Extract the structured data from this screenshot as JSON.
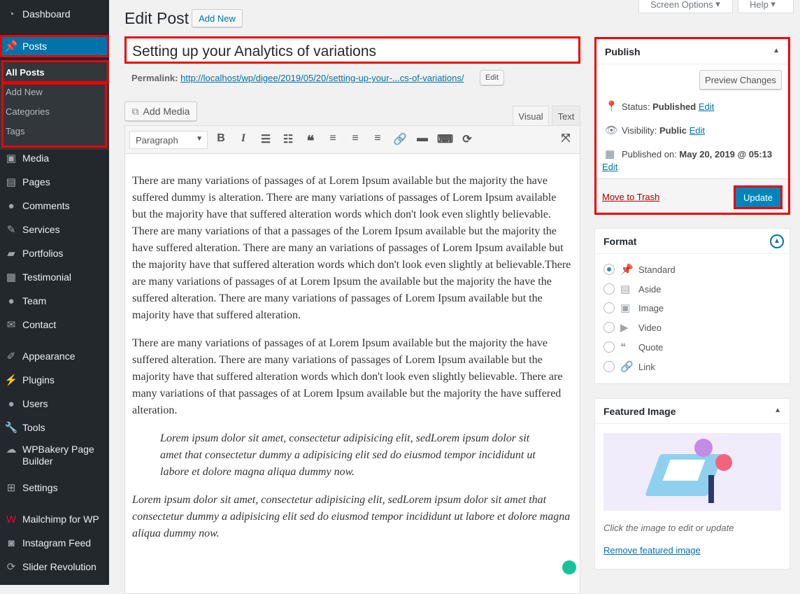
{
  "sidebar": {
    "items": [
      {
        "label": "Dashboard",
        "icon": "dashboard-icon"
      },
      {
        "label": "Posts",
        "icon": "pin-icon"
      },
      {
        "label": "Media",
        "icon": "media-icon"
      },
      {
        "label": "Pages",
        "icon": "pages-icon"
      },
      {
        "label": "Comments",
        "icon": "comments-icon"
      },
      {
        "label": "Services",
        "icon": "wrench-icon"
      },
      {
        "label": "Portfolios",
        "icon": "folder-icon"
      },
      {
        "label": "Testimonial",
        "icon": "testimonial-icon"
      },
      {
        "label": "Team",
        "icon": "user-icon"
      },
      {
        "label": "Contact",
        "icon": "mail-icon"
      },
      {
        "label": "Appearance",
        "icon": "brush-icon"
      },
      {
        "label": "Plugins",
        "icon": "plugin-icon"
      },
      {
        "label": "Users",
        "icon": "users-icon"
      },
      {
        "label": "Tools",
        "icon": "tools-icon"
      },
      {
        "label": "WPBakery Page Builder",
        "icon": "wpbakery-icon"
      },
      {
        "label": "Settings",
        "icon": "settings-icon"
      },
      {
        "label": "Mailchimp for WP",
        "icon": "mailchimp-icon"
      },
      {
        "label": "Instagram Feed",
        "icon": "instagram-icon"
      },
      {
        "label": "Slider Revolution",
        "icon": "slider-icon"
      }
    ],
    "submenu": [
      "All Posts",
      "Add New",
      "Categories",
      "Tags"
    ]
  },
  "header": {
    "screen_options": "Screen Options",
    "help": "Help",
    "title": "Edit Post",
    "add_new": "Add New"
  },
  "post": {
    "title": "Setting up your Analytics of variations",
    "permalink_label": "Permalink:",
    "permalink": "http://localhost/wp/digee/2019/05/20/setting-up-your-...cs-of-variations/",
    "permalink_edit": "Edit"
  },
  "editor": {
    "add_media": "Add Media",
    "tab_visual": "Visual",
    "tab_text": "Text",
    "format": "Paragraph",
    "paragraphs": [
      "There are many variations of passages of at Lorem Ipsum available but the majority the have suffered dummy is alteration. There are many variations of passages of Lorem Ipsum available but the majority have that suffered alteration words which don't look even slightly believable. There are many variations of that a passages of the Lorem Ipsum available but the majority the have suffered alteration. There are many an variations of passages of Lorem Ipsum available but the majority have that suffered alteration words which don't look even slightly at believable.There are many variations of passages of at Lorem Ipsum the available but the majority the have the suffered alteration. There are many variations of passages of Lorem Ipsum available but the majority have that suffered alteration.",
      "There are many variations of passages of at Lorem Ipsum available but the majority the have suffered alteration. There are many variations of passages of Lorem Ipsum available but the majority have that suffered alteration words which don't look even slightly believable. There are many variations of that passages of at Lorem Ipsum available but the majority the have suffered alteration."
    ],
    "blockquote": "Lorem ipsum dolor sit amet, consectetur adipisicing elit, sedLorem ipsum dolor sit amet that consectetur dummy a adipisicing elit sed do eiusmod tempor incididunt ut labore et dolore magna aliqua dummy now.",
    "italic": "Lorem ipsum dolor sit amet, consectetur adipisicing elit, sedLorem ipsum dolor sit amet that consectetur dummy a adipisicing elit sed do eiusmod tempor incididunt ut labore et dolore magna aliqua dummy now."
  },
  "publish": {
    "title": "Publish",
    "preview": "Preview Changes",
    "status_label": "Status:",
    "status": "Published",
    "visibility_label": "Visibility:",
    "visibility": "Public",
    "published_label": "Published on:",
    "published": "May 20, 2019 @ 05:13",
    "edit": "Edit",
    "trash": "Move to Trash",
    "update": "Update"
  },
  "format": {
    "title": "Format",
    "options": [
      "Standard",
      "Aside",
      "Image",
      "Video",
      "Quote",
      "Link"
    ],
    "selected": "Standard"
  },
  "featured": {
    "title": "Featured Image",
    "hint": "Click the image to edit or update",
    "remove": "Remove featured image"
  },
  "colors": {
    "accent": "#0073aa",
    "highlight": "#ee0000",
    "sidebar": "#23282d"
  }
}
